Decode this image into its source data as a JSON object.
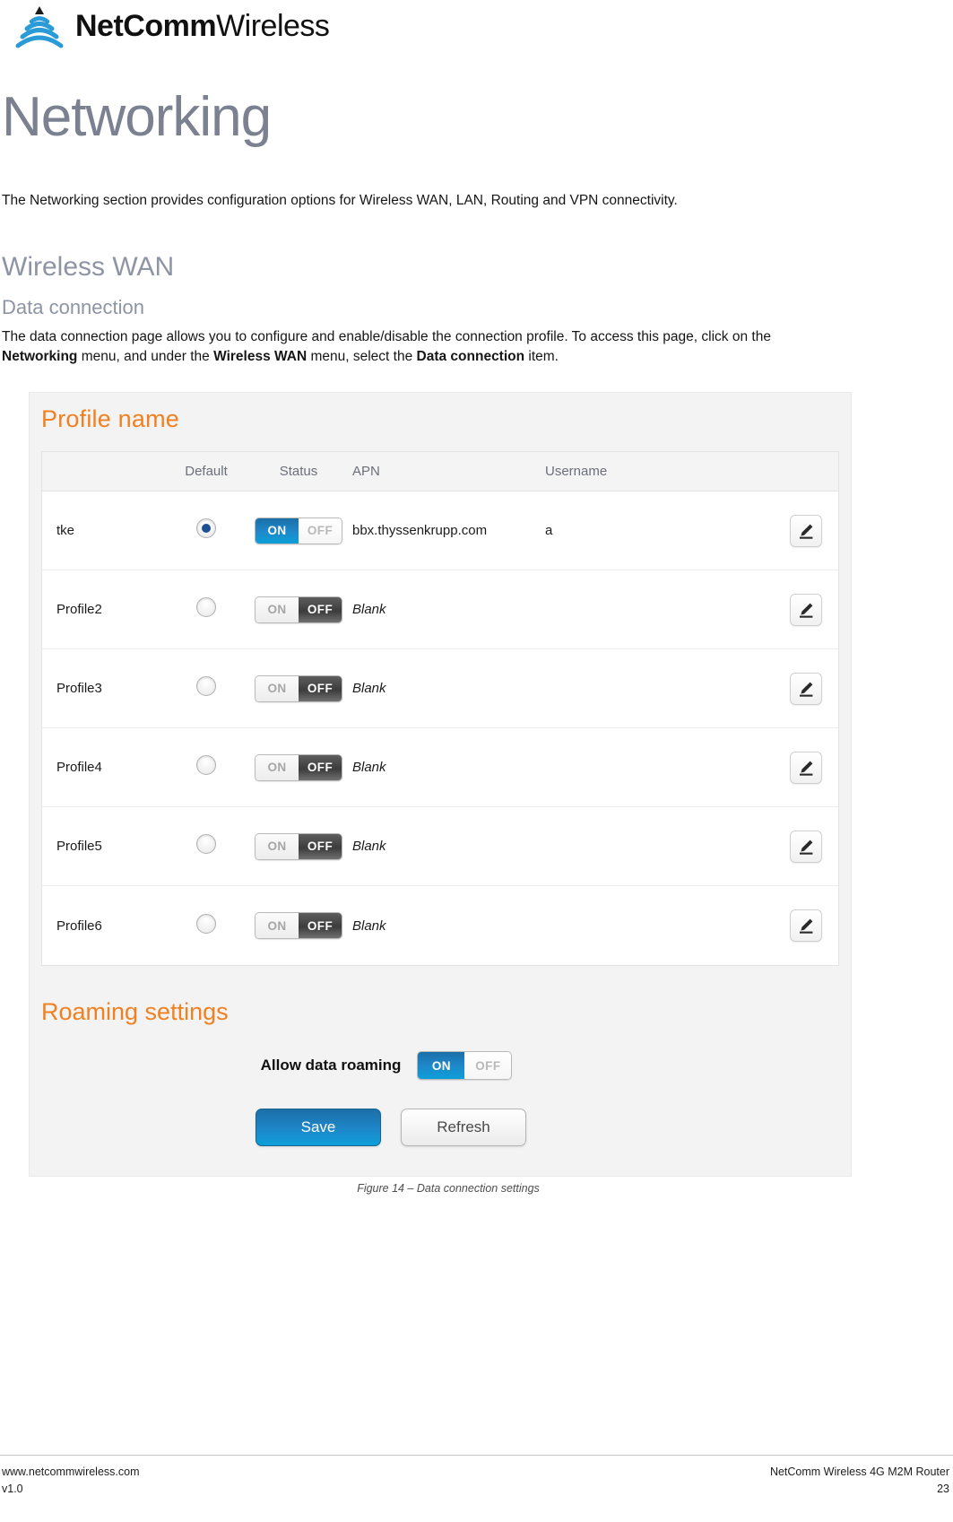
{
  "brand": {
    "name_bold": "NetComm",
    "name_light": "Wireless",
    "logo_icon": "wifi-wave-icon",
    "logo_color": "#2a9bd6"
  },
  "page": {
    "title": "Networking",
    "intro": "The Networking section provides configuration options for Wireless WAN, LAN, Routing and VPN connectivity.",
    "section_heading": "Wireless WAN",
    "sub_heading": "Data connection",
    "paragraph": {
      "part1": "The data connection page allows you to configure and enable/disable the connection profile. To access this page, click on the ",
      "bold1": "Networking",
      "part2": " menu, and under the ",
      "bold2": "Wireless WAN",
      "part3": " menu, select the ",
      "bold3": "Data connection",
      "part4": " item."
    },
    "figure_caption": "Figure 14 – Data connection settings"
  },
  "colors": {
    "accent_orange": "#f08020",
    "heading_gray": "#8d94a4",
    "toggle_on_blue": "#1e87c9",
    "radio_dot": "#1d4f91"
  },
  "screenshot": {
    "profile_panel_title": "Profile name",
    "columns": [
      "",
      "Default",
      "Status",
      "APN",
      "Username",
      ""
    ],
    "rows": [
      {
        "name": "tke",
        "default_selected": true,
        "status": "ON",
        "apn": "bbx.thyssenkrupp.com",
        "apn_blank": false,
        "username": "a",
        "edit_icon": "pencil-icon"
      },
      {
        "name": "Profile2",
        "default_selected": false,
        "status": "OFF",
        "apn": "Blank",
        "apn_blank": true,
        "username": "",
        "edit_icon": "pencil-icon"
      },
      {
        "name": "Profile3",
        "default_selected": false,
        "status": "OFF",
        "apn": "Blank",
        "apn_blank": true,
        "username": "",
        "edit_icon": "pencil-icon"
      },
      {
        "name": "Profile4",
        "default_selected": false,
        "status": "OFF",
        "apn": "Blank",
        "apn_blank": true,
        "username": "",
        "edit_icon": "pencil-icon"
      },
      {
        "name": "Profile5",
        "default_selected": false,
        "status": "OFF",
        "apn": "Blank",
        "apn_blank": true,
        "username": "",
        "edit_icon": "pencil-icon"
      },
      {
        "name": "Profile6",
        "default_selected": false,
        "status": "OFF",
        "apn": "Blank",
        "apn_blank": true,
        "username": "",
        "edit_icon": "pencil-icon"
      }
    ],
    "toggle_labels": {
      "on": "ON",
      "off": "OFF"
    },
    "roaming": {
      "title": "Roaming settings",
      "label": "Allow data roaming",
      "state": "ON"
    },
    "buttons": {
      "save": "Save",
      "refresh": "Refresh"
    }
  },
  "footer": {
    "website": "www.netcommwireless.com",
    "version": "v1.0",
    "product": "NetComm Wireless 4G M2M Router",
    "page_number": "23"
  }
}
